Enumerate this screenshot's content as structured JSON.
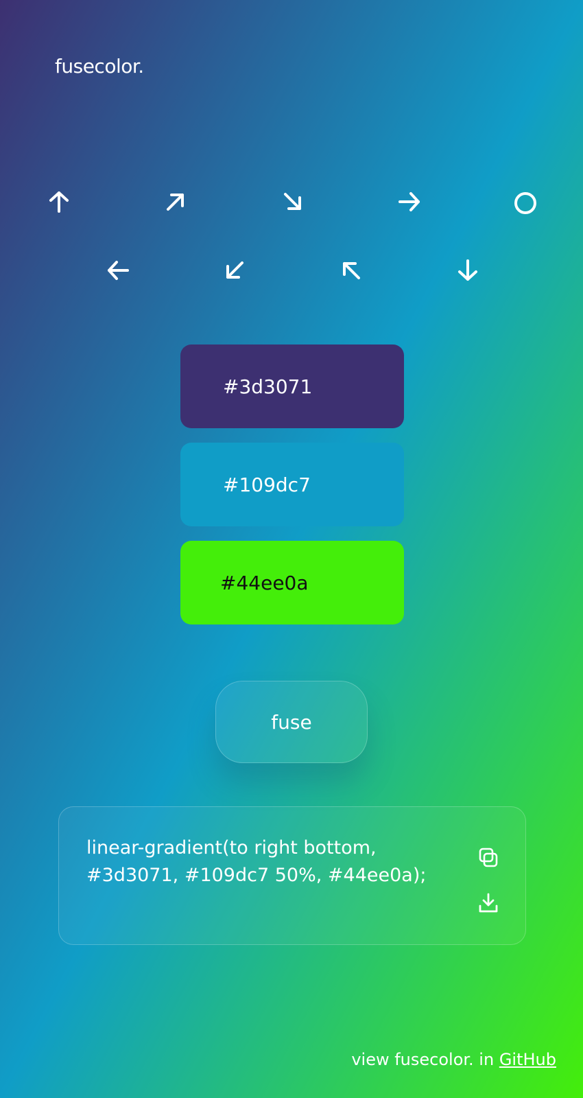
{
  "app": {
    "logo": "fusecolor."
  },
  "directions": {
    "row1": [
      {
        "icon": "arrow-up-icon",
        "label": "to top"
      },
      {
        "icon": "arrow-up-right-icon",
        "label": "to right top"
      },
      {
        "icon": "arrow-down-right-icon",
        "label": "to right bottom"
      },
      {
        "icon": "arrow-right-icon",
        "label": "to right"
      },
      {
        "icon": "circle-icon",
        "label": "radial"
      }
    ],
    "row2": [
      {
        "icon": "arrow-left-icon",
        "label": "to left"
      },
      {
        "icon": "arrow-down-left-icon",
        "label": "to left bottom"
      },
      {
        "icon": "arrow-up-left-icon",
        "label": "to left top"
      },
      {
        "icon": "arrow-down-icon",
        "label": "to bottom"
      }
    ]
  },
  "colors": [
    {
      "hex": "#3d3071",
      "text_color": "#ffffff"
    },
    {
      "hex": "#109dc7",
      "text_color": "#ffffff"
    },
    {
      "hex": "#44ee0a",
      "text_color": "#111111"
    }
  ],
  "fuse_button": {
    "label": "fuse"
  },
  "output": {
    "line1": "linear-gradient(to right bottom,",
    "line2": "#3d3071, #109dc7 50%, #44ee0a);",
    "copy_icon": "copy-icon",
    "download_icon": "download-icon"
  },
  "footer": {
    "text": "view fusecolor. in",
    "link": "GitHub"
  },
  "background": {
    "direction": "to right bottom",
    "stops": [
      "#3d3071",
      "#109dc7 50%",
      "#44ee0a"
    ]
  }
}
